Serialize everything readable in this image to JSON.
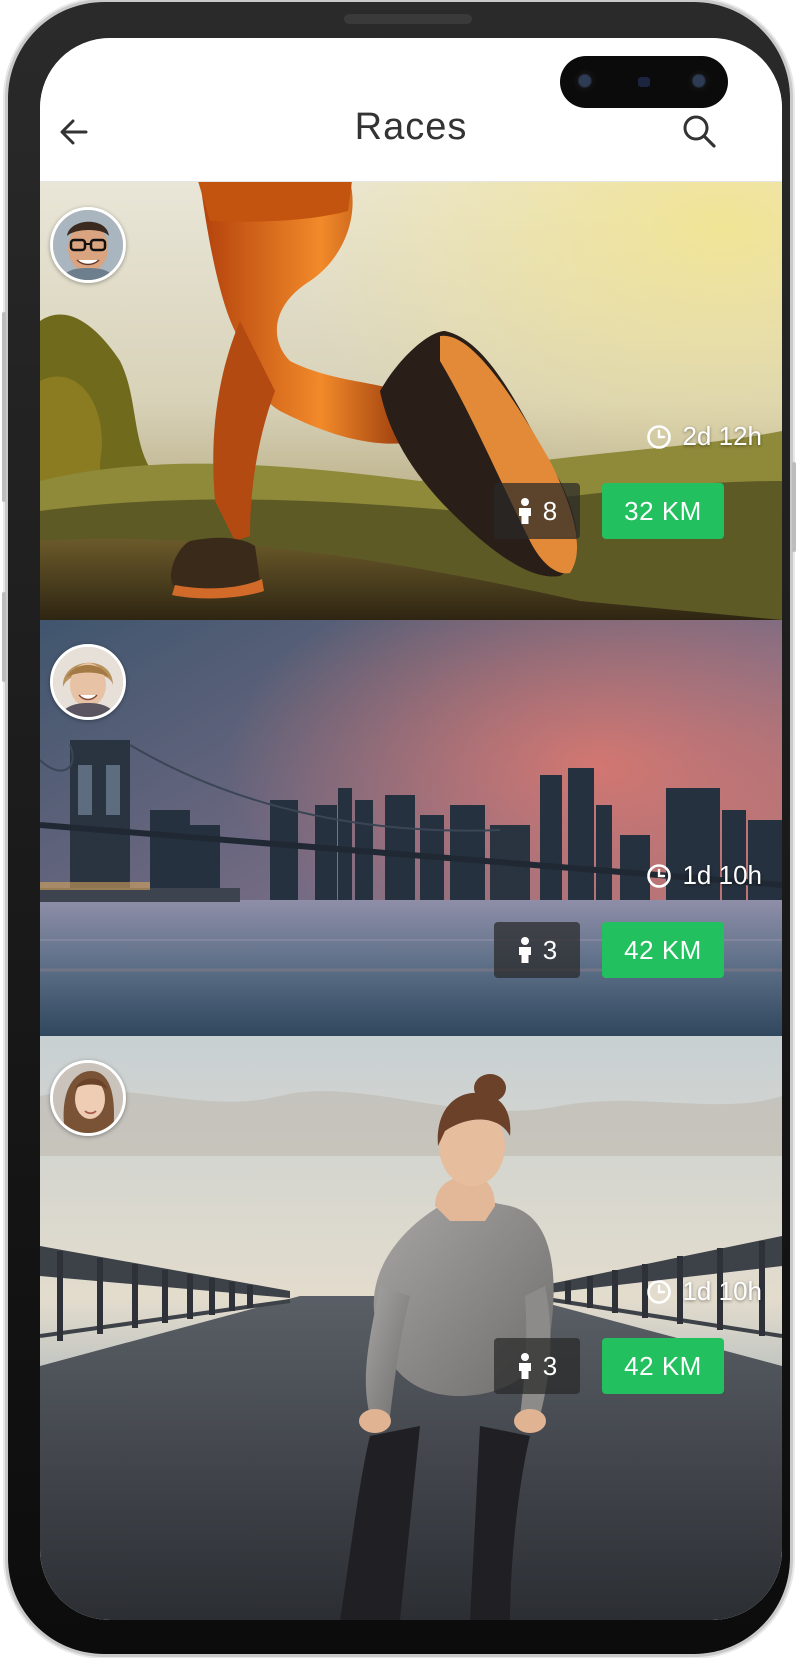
{
  "header": {
    "title": "Races",
    "back_icon": "arrow-left-icon",
    "search_icon": "search-icon"
  },
  "races": [
    {
      "time_left": "2d 12h",
      "participants": "8",
      "distance": "32 KM"
    },
    {
      "time_left": "1d 10h",
      "participants": "3",
      "distance": "42 KM"
    },
    {
      "time_left": "1d 10h",
      "participants": "3",
      "distance": "42 KM"
    }
  ],
  "colors": {
    "accent_green": "#22c05e",
    "participants_bg": "#282828",
    "title_text": "#333333"
  }
}
